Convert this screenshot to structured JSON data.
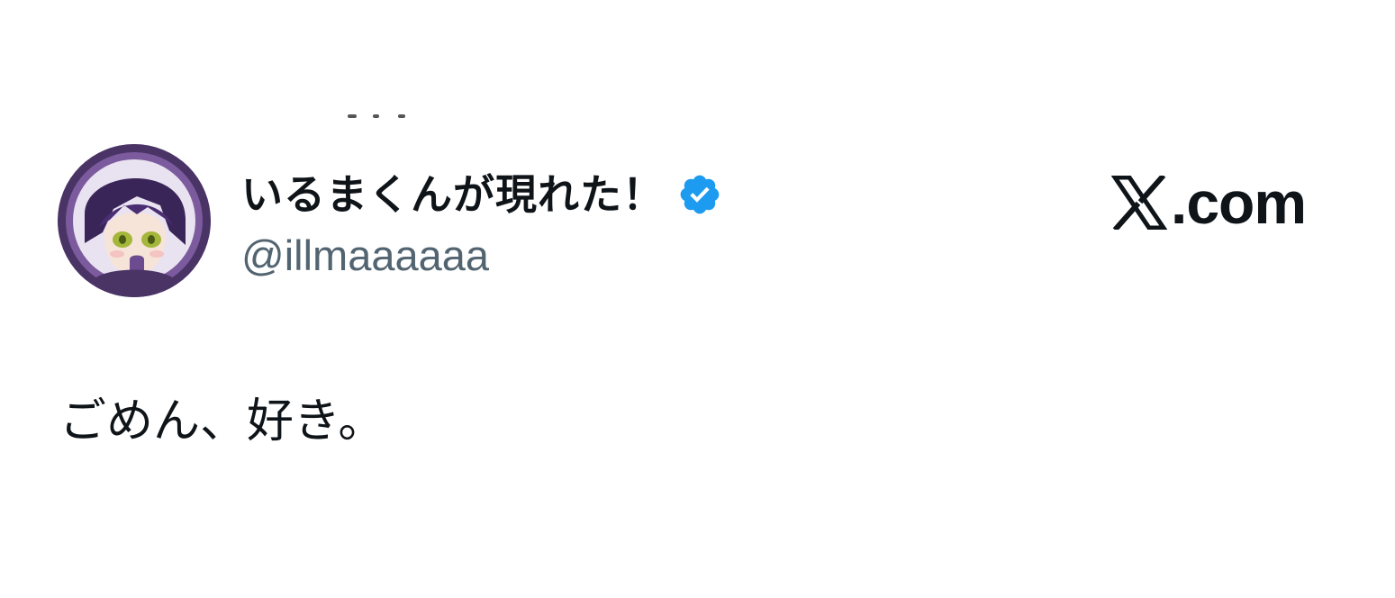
{
  "profile": {
    "display_name": "いるまくんが現れた！",
    "handle": "@illmaaaaaa",
    "verified_icon": "verified-check-icon",
    "avatar_icon": "anime-avatar"
  },
  "brand": {
    "logo_icon": "x-logo-icon",
    "suffix": ".com"
  },
  "tweet": {
    "text": "ごめん、好き。"
  },
  "colors": {
    "verified": "#1d9bf0",
    "handle": "#536471",
    "text": "#0f1419",
    "background": "#ffffff"
  }
}
